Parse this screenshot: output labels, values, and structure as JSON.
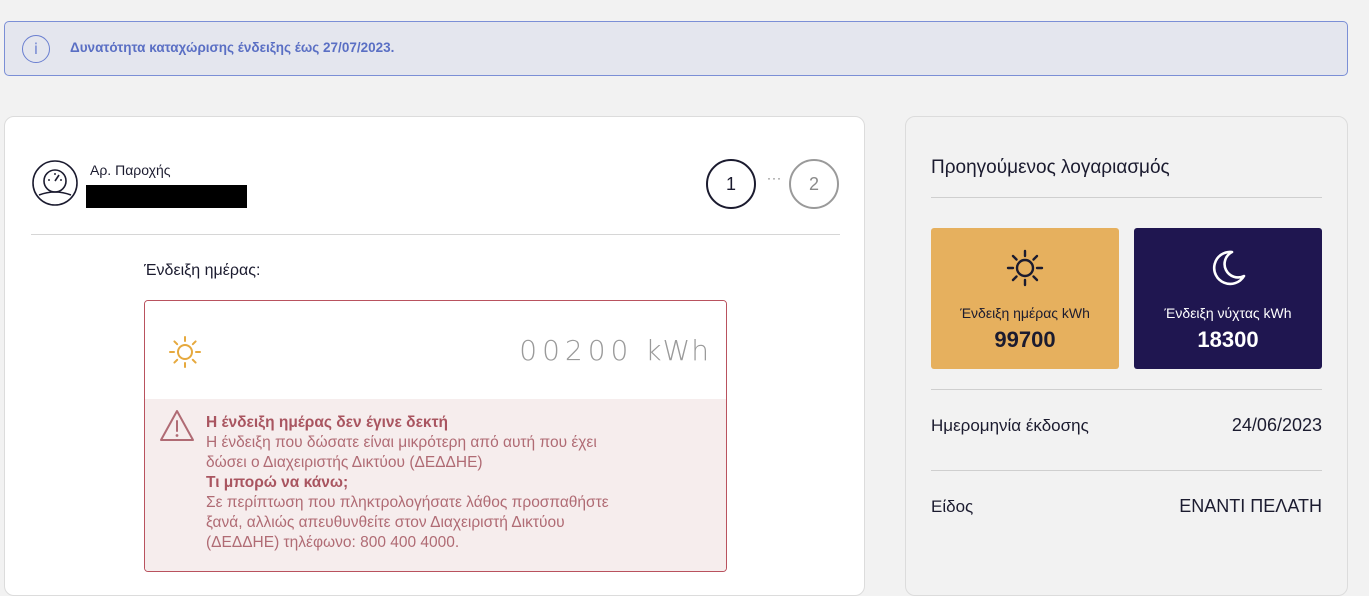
{
  "banner": {
    "icon": "info-icon",
    "icon_glyph": "i",
    "text": "Δυνατότητα καταχώρισης ένδειξης έως 27/07/2023."
  },
  "supply": {
    "icon": "meter-icon",
    "label": "Αρ. Παροχής"
  },
  "steps": {
    "step1": "1",
    "dots": "···",
    "step2": "2"
  },
  "reading": {
    "label": "Ένδειξη ημέρας:",
    "icon": "sun-icon",
    "value": "00200",
    "unit": "kWh"
  },
  "error": {
    "icon": "warning-icon",
    "title": "Η ένδειξη ημέρας δεν έγινε δεκτή",
    "description_line1": "Η ένδειξη που δώσατε είναι μικρότερη από αυτή που έχει",
    "description_line2": "δώσει ο Διαχειριστής Δικτύου (ΔΕΔΔΗΕ)",
    "help_title": "Τι μπορώ να κάνω;",
    "help_line1": "Σε περίπτωση που πληκτρολογήσατε λάθος προσπαθήστε",
    "help_line2": "ξανά, αλλιώς απευθυνθείτε στον Διαχειριστή Δικτύου",
    "help_line3": "(ΔΕΔΔΗΕ) τηλέφωνο: 800 400 4000."
  },
  "previous_bill": {
    "title": "Προηγούμενος λογαριασμός",
    "day_tile": {
      "icon": "sun-icon",
      "label": "Ένδειξη ημέρας kWh",
      "value": "99700"
    },
    "night_tile": {
      "icon": "moon-icon",
      "label": "Ένδειξη νύχτας kWh",
      "value": "18300"
    },
    "issue_date_label": "Ημερομηνία έκδοσης",
    "issue_date_value": "24/06/2023",
    "type_label": "Είδος",
    "type_value": "ΕΝΑΝΤΙ ΠΕΛΑΤΗ"
  },
  "colors": {
    "accent_blue": "#6a7fd0",
    "error_border": "#b9525e",
    "error_bg": "#f6eded",
    "day_tile": "#e6b05e",
    "night_tile": "#1f1650"
  }
}
